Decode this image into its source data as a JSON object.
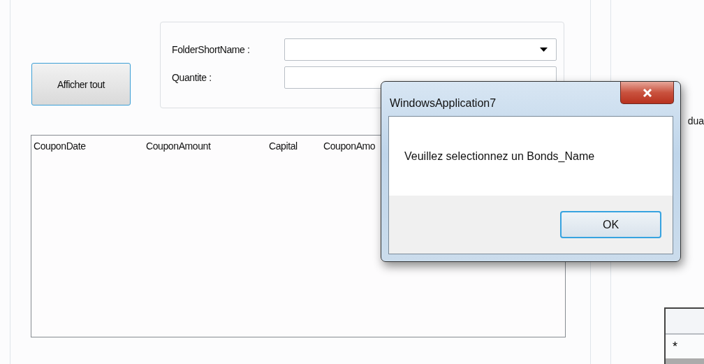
{
  "form": {
    "show_all_button": "Afficher tout",
    "filters": [
      {
        "label": "FolderShortName :",
        "kind": "dropdown"
      },
      {
        "label": "Quantite :",
        "kind": "text"
      }
    ],
    "list_columns": [
      "CouponDate",
      "CouponAmount",
      "Capital",
      "CouponAmo"
    ],
    "side_label": "dua",
    "grid": {
      "new_row_marker": "*"
    }
  },
  "dialog": {
    "title": "WindowsApplication7",
    "message": "Veuillez selectionnez un Bonds_Name",
    "buttons": [
      "OK"
    ]
  }
}
